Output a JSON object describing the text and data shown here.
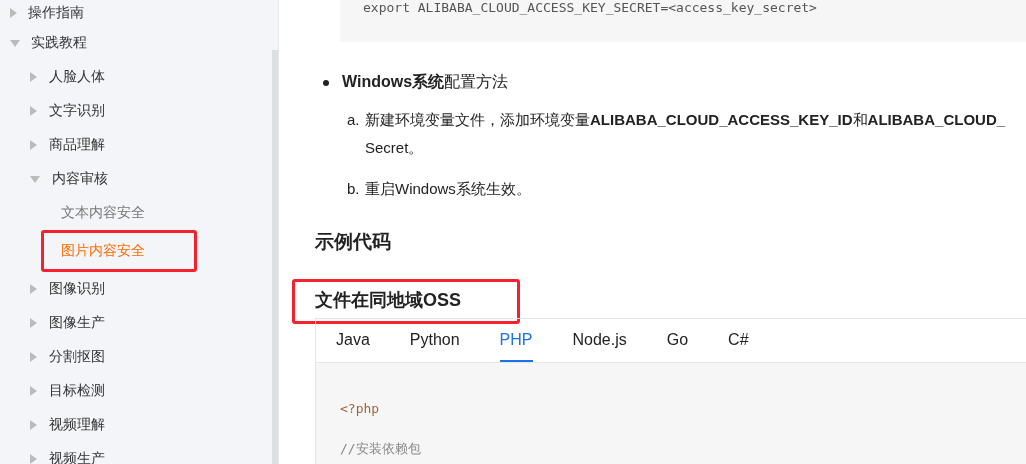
{
  "sidebar": {
    "items": [
      {
        "label": "操作指南",
        "expanded": false,
        "selected": false
      },
      {
        "label": "实践教程",
        "expanded": true,
        "selected": false,
        "children": [
          {
            "label": "人脸人体",
            "expanded": false,
            "selected": false
          },
          {
            "label": "文字识别",
            "expanded": false,
            "selected": false
          },
          {
            "label": "商品理解",
            "expanded": false,
            "selected": false
          },
          {
            "label": "内容审核",
            "expanded": true,
            "selected": false,
            "children": [
              {
                "label": "文本内容安全",
                "selected": false
              },
              {
                "label": "图片内容安全",
                "selected": true,
                "annotated": true
              }
            ]
          },
          {
            "label": "图像识别",
            "expanded": false,
            "selected": false
          },
          {
            "label": "图像生产",
            "expanded": false,
            "selected": false
          },
          {
            "label": "分割抠图",
            "expanded": false,
            "selected": false
          },
          {
            "label": "目标检测",
            "expanded": false,
            "selected": false
          },
          {
            "label": "视频理解",
            "expanded": false,
            "selected": false
          },
          {
            "label": "视频生产",
            "expanded": false,
            "selected": false
          }
        ]
      }
    ]
  },
  "content": {
    "code_block": "export ALIBABA_CLOUD_ACCESS_KEY_SECRET=<access_key_secret>",
    "bullet": "**Windows系统**配置方法",
    "steps": [
      {
        "marker": "a.",
        "lines": [
          "新建环境变量文件，添加环境变量**ALIBABA_CLOUD_ACCESS_KEY_ID**和**ALIBABA_CLOUD_**",
          "Secret。"
        ]
      },
      {
        "marker": "b.",
        "lines": [
          "重启Windows系统生效。"
        ]
      }
    ],
    "heading": "示例代码",
    "subheading": {
      "text": "文件在同地域OSS",
      "annotated": true
    },
    "tabs": [
      {
        "label": "Java",
        "selected": false
      },
      {
        "label": "Python",
        "selected": false
      },
      {
        "label": "PHP",
        "selected": true
      },
      {
        "label": "Node.js",
        "selected": false
      },
      {
        "label": "Go",
        "selected": false
      },
      {
        "label": "C#",
        "selected": false
      }
    ],
    "code_lines": [
      {
        "kind": "keyword",
        "text": "<?php"
      },
      {
        "kind": "comment",
        "text": "//安装依赖包"
      }
    ]
  }
}
